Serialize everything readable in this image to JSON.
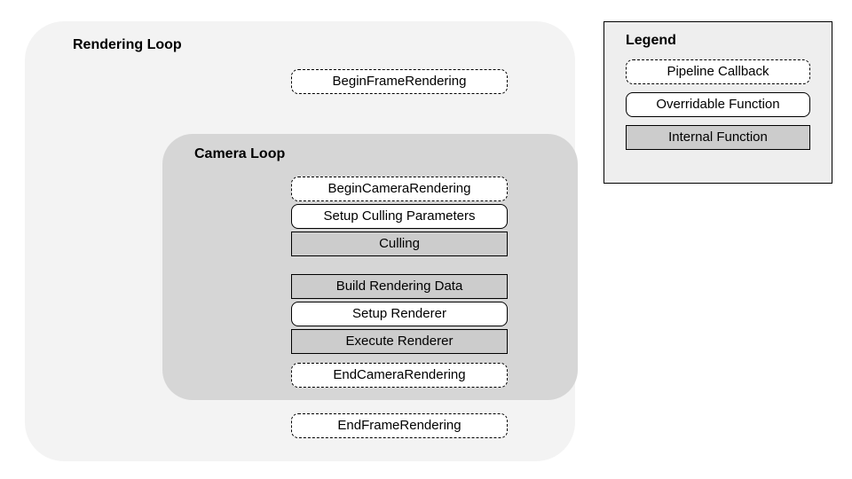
{
  "outer": {
    "title": "Rendering Loop",
    "begin": "BeginFrameRendering",
    "end": "EndFrameRendering"
  },
  "inner": {
    "title": "Camera Loop",
    "begin": "BeginCameraRendering",
    "setup_culling": "Setup Culling Parameters",
    "culling": "Culling",
    "build_data": "Build Rendering Data",
    "setup_renderer": "Setup Renderer",
    "execute_renderer": "Execute Renderer",
    "end": "EndCameraRendering"
  },
  "legend": {
    "title": "Legend",
    "callback": "Pipeline Callback",
    "overridable": "Overridable Function",
    "internal": "Internal Function"
  }
}
